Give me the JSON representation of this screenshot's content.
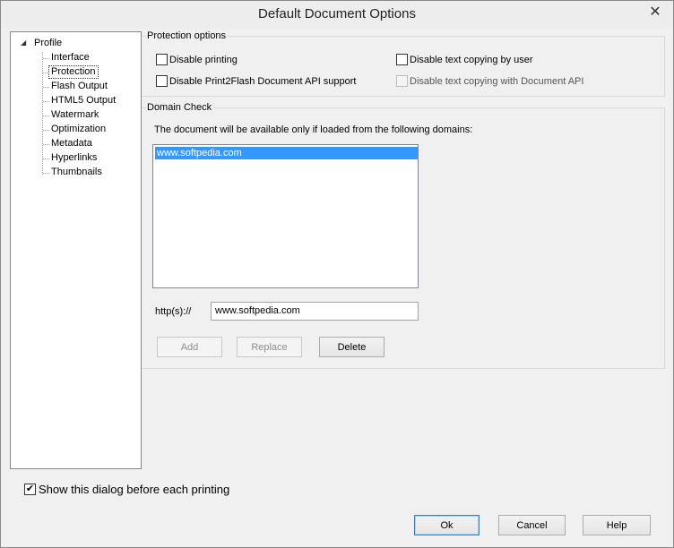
{
  "window": {
    "title": "Default Document Options",
    "close_symbol": "✕"
  },
  "tree": {
    "root": "Profile",
    "items": [
      "Interface",
      "Protection",
      "Flash Output",
      "HTML5 Output",
      "Watermark",
      "Optimization",
      "Metadata",
      "Hyperlinks",
      "Thumbnails"
    ],
    "selected": "Protection"
  },
  "protection": {
    "group_label": "Protection options",
    "disable_printing": "Disable printing",
    "disable_api": "Disable Print2Flash Document API support",
    "disable_copy_user": "Disable text copying by user",
    "disable_copy_api": "Disable text copying with Document API"
  },
  "domain": {
    "group_label": "Domain Check",
    "description": "The document will be available only if loaded from the following domains:",
    "list": [
      "www.softpedia.com"
    ],
    "prefix": "http(s)://",
    "input_value": "www.softpedia.com",
    "add": "Add",
    "replace": "Replace",
    "delete": "Delete"
  },
  "footer": {
    "show_dialog": "Show this dialog before each printing",
    "ok": "Ok",
    "cancel": "Cancel",
    "help": "Help"
  },
  "check_glyph": "✔",
  "tree_expander_glyph": "◢"
}
